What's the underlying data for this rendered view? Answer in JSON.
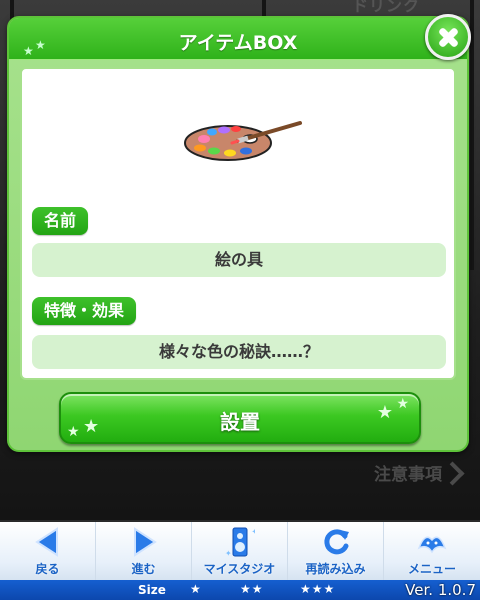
{
  "backdrop": {
    "partial_text": "ドリンク",
    "notice_link": "注意事項"
  },
  "modal": {
    "title": "アイテムBOX",
    "item_icon": "paint-palette-icon",
    "name_tag": "名前",
    "name_value": "絵の具",
    "feature_tag": "特徴・効果",
    "feature_value": "様々な色の秘訣……？",
    "install_label": "設置",
    "close_icon": "close-icon"
  },
  "bottom_nav": {
    "items": [
      {
        "label": "戻る",
        "icon": "back-arrow-icon"
      },
      {
        "label": "進む",
        "icon": "forward-arrow-icon"
      },
      {
        "label": "マイスタジオ",
        "icon": "speaker-icon"
      },
      {
        "label": "再読み込み",
        "icon": "reload-icon"
      },
      {
        "label": "メニュー",
        "icon": "menu-mascot-icon"
      }
    ]
  },
  "footer": {
    "size_label": "Size",
    "size_small": "★",
    "size_medium": "★★",
    "size_large": "★★★",
    "version": "Ver. 1.0.7"
  },
  "colors": {
    "accent_green": "#2fb21a",
    "nav_blue": "#1b63c5",
    "footer_blue": "#0c47ad"
  }
}
